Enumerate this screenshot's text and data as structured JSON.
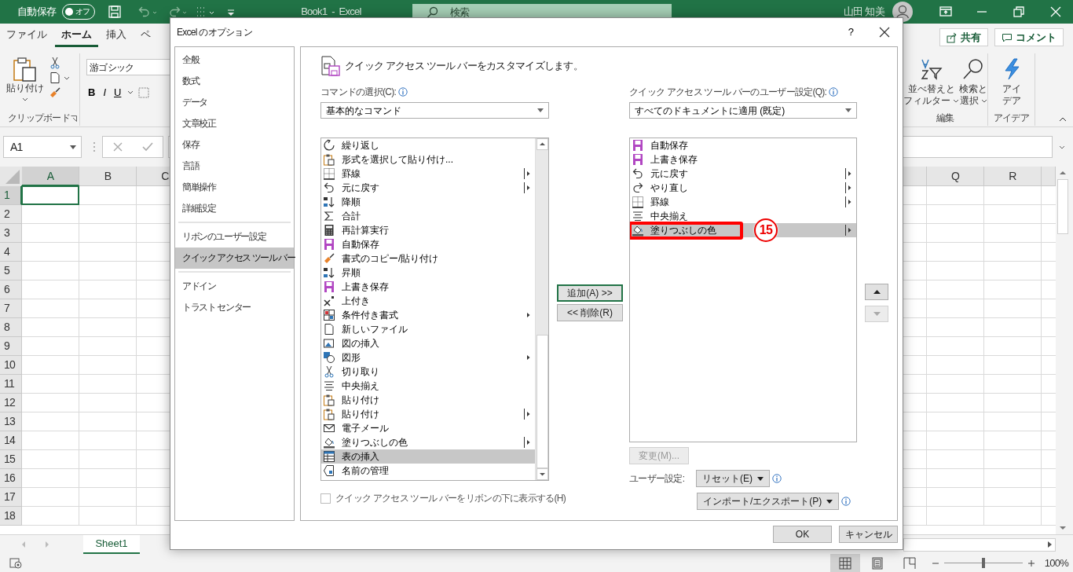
{
  "excel": {
    "title_bar": {
      "autosave_label": "自動保存",
      "autosave": {
        "on": false,
        "label": "オフ"
      },
      "title": "Book1  -  Excel",
      "search_placeholder": "検索",
      "user_name": "山田 知美"
    },
    "ribbon_tabs": [
      {
        "label": "ファイル",
        "selected": false
      },
      {
        "label": "ホーム",
        "selected": true
      },
      {
        "label": "挿入",
        "selected": false
      },
      {
        "label": "ペ",
        "selected": false
      }
    ],
    "share_button": "共有",
    "comment_button": "コメント",
    "clipboard": {
      "paste_label": "貼り付け",
      "group_label": "クリップボード"
    },
    "font": {
      "font_name": "游ゴシック",
      "format_buttons": [
        "B",
        "I",
        "U"
      ]
    },
    "editing": {
      "sort_filter": [
        "並べ替えと",
        "フィルター"
      ],
      "find_select": [
        "検索と",
        "選択"
      ],
      "group_label": "編集"
    },
    "ideas": {
      "button": [
        "アイ",
        "デア"
      ],
      "group_label": "アイデア"
    },
    "name_box": "A1",
    "columns_left": [
      {
        "label": "A",
        "selected": true
      },
      {
        "label": "B",
        "selected": false
      },
      {
        "label": "C",
        "selected": false
      }
    ],
    "columns_right": [
      {
        "label": "Q",
        "selected": false
      },
      {
        "label": "R",
        "selected": false
      }
    ],
    "rows": [
      {
        "label": "1",
        "selected": true
      },
      {
        "label": "2",
        "selected": false
      },
      {
        "label": "3",
        "selected": false
      },
      {
        "label": "4",
        "selected": false
      },
      {
        "label": "5",
        "selected": false
      },
      {
        "label": "6",
        "selected": false
      },
      {
        "label": "7",
        "selected": false
      },
      {
        "label": "8",
        "selected": false
      },
      {
        "label": "9",
        "selected": false
      },
      {
        "label": "10",
        "selected": false
      },
      {
        "label": "11",
        "selected": false
      },
      {
        "label": "12",
        "selected": false
      },
      {
        "label": "13",
        "selected": false
      },
      {
        "label": "14",
        "selected": false
      },
      {
        "label": "15",
        "selected": false
      },
      {
        "label": "16",
        "selected": false
      },
      {
        "label": "17",
        "selected": false
      },
      {
        "label": "18",
        "selected": false
      }
    ],
    "sheet_tabs": [
      {
        "label": "Sheet1",
        "selected": true
      }
    ],
    "status_bar": {
      "views": [
        {
          "kind": "normal",
          "selected": true
        },
        {
          "kind": "page_layout",
          "selected": false
        },
        {
          "kind": "page_break",
          "selected": false
        }
      ],
      "zoom": {
        "level": 0.5,
        "label": "100%"
      }
    }
  },
  "dialog": {
    "title": "Excel のオプション",
    "help": "?",
    "nav_sections": [
      [
        {
          "label": "全般",
          "selected": false
        },
        {
          "label": "数式",
          "selected": false
        },
        {
          "label": "データ",
          "selected": false
        },
        {
          "label": "文章校正",
          "selected": false
        },
        {
          "label": "保存",
          "selected": false
        },
        {
          "label": "言語",
          "selected": false
        },
        {
          "label": "簡単操作",
          "selected": false
        },
        {
          "label": "詳細設定",
          "selected": false
        }
      ],
      [
        {
          "label": "リボンのユーザー設定",
          "selected": false
        },
        {
          "label": "クイック アクセス ツール バー",
          "selected": true
        }
      ],
      [
        {
          "label": "アドイン",
          "selected": false
        },
        {
          "label": "トラスト センター",
          "selected": false
        }
      ]
    ],
    "heading": "クイック アクセス ツール バーをカスタマイズします。",
    "commands_label": "コマンドの選択(C):",
    "commands_select": "基本的なコマンド",
    "commands": [
      {
        "label": "繰り返し",
        "submenu": false,
        "split": false,
        "selected": false
      },
      {
        "label": "形式を選択して貼り付け...",
        "submenu": false,
        "split": false,
        "selected": false
      },
      {
        "label": "罫線",
        "submenu": true,
        "split": true,
        "selected": false
      },
      {
        "label": "元に戻す",
        "submenu": true,
        "split": true,
        "selected": false
      },
      {
        "label": "降順",
        "submenu": false,
        "split": false,
        "selected": false
      },
      {
        "label": "合計",
        "submenu": false,
        "split": false,
        "selected": false
      },
      {
        "label": "再計算実行",
        "submenu": false,
        "split": false,
        "selected": false
      },
      {
        "label": "自動保存",
        "submenu": false,
        "split": false,
        "selected": false
      },
      {
        "label": "書式のコピー/貼り付け",
        "submenu": false,
        "split": false,
        "selected": false
      },
      {
        "label": "昇順",
        "submenu": false,
        "split": false,
        "selected": false
      },
      {
        "label": "上書き保存",
        "submenu": false,
        "split": false,
        "selected": false
      },
      {
        "label": "上付き",
        "submenu": false,
        "split": false,
        "selected": false
      },
      {
        "label": "条件付き書式",
        "submenu": true,
        "split": false,
        "selected": false
      },
      {
        "label": "新しいファイル",
        "submenu": false,
        "split": false,
        "selected": false
      },
      {
        "label": "図の挿入",
        "submenu": false,
        "split": false,
        "selected": false
      },
      {
        "label": "図形",
        "submenu": true,
        "split": false,
        "selected": false
      },
      {
        "label": "切り取り",
        "submenu": false,
        "split": false,
        "selected": false
      },
      {
        "label": "中央揃え",
        "submenu": false,
        "split": false,
        "selected": false
      },
      {
        "label": "貼り付け",
        "submenu": false,
        "split": false,
        "selected": false
      },
      {
        "label": "貼り付け",
        "submenu": true,
        "split": true,
        "selected": false
      },
      {
        "label": "電子メール",
        "submenu": false,
        "split": false,
        "selected": false
      },
      {
        "label": "塗りつぶしの色",
        "submenu": true,
        "split": true,
        "selected": false
      },
      {
        "label": "表の挿入",
        "submenu": false,
        "split": false,
        "selected": true
      },
      {
        "label": "名前の管理",
        "submenu": false,
        "split": false,
        "selected": false
      }
    ],
    "add_button": "追加(A) >>",
    "remove_button": "<< 削除(R)",
    "qat_label": "クイック アクセス ツール バーのユーザー設定(Q):",
    "qat_select": "すべてのドキュメントに適用 (既定)",
    "qat_items": [
      {
        "label": "自動保存",
        "submenu": false,
        "split": false,
        "selected": false
      },
      {
        "label": "上書き保存",
        "submenu": false,
        "split": false,
        "selected": false
      },
      {
        "label": "元に戻す",
        "submenu": true,
        "split": true,
        "selected": false
      },
      {
        "label": "やり直し",
        "submenu": true,
        "split": true,
        "selected": false
      },
      {
        "label": "罫線",
        "submenu": true,
        "split": true,
        "selected": false
      },
      {
        "label": "中央揃え",
        "submenu": false,
        "split": false,
        "selected": false
      },
      {
        "label": "塗りつぶしの色",
        "submenu": true,
        "split": true,
        "selected": true
      }
    ],
    "callout": "15",
    "move_up": {
      "disabled": false
    },
    "move_down": {
      "disabled": true
    },
    "modify_button": {
      "label": "変更(M)...",
      "disabled": true
    },
    "customizations_label": "ユーザー設定:",
    "reset_button": "リセット(E)",
    "import_export_button": "インポート/エクスポート(P)",
    "below_ribbon": {
      "label": "クイック アクセス ツール バーをリボンの下に表示する(H)",
      "checked": false,
      "disabled": true
    },
    "ok_button": "OK",
    "cancel_button": "キャンセル"
  }
}
